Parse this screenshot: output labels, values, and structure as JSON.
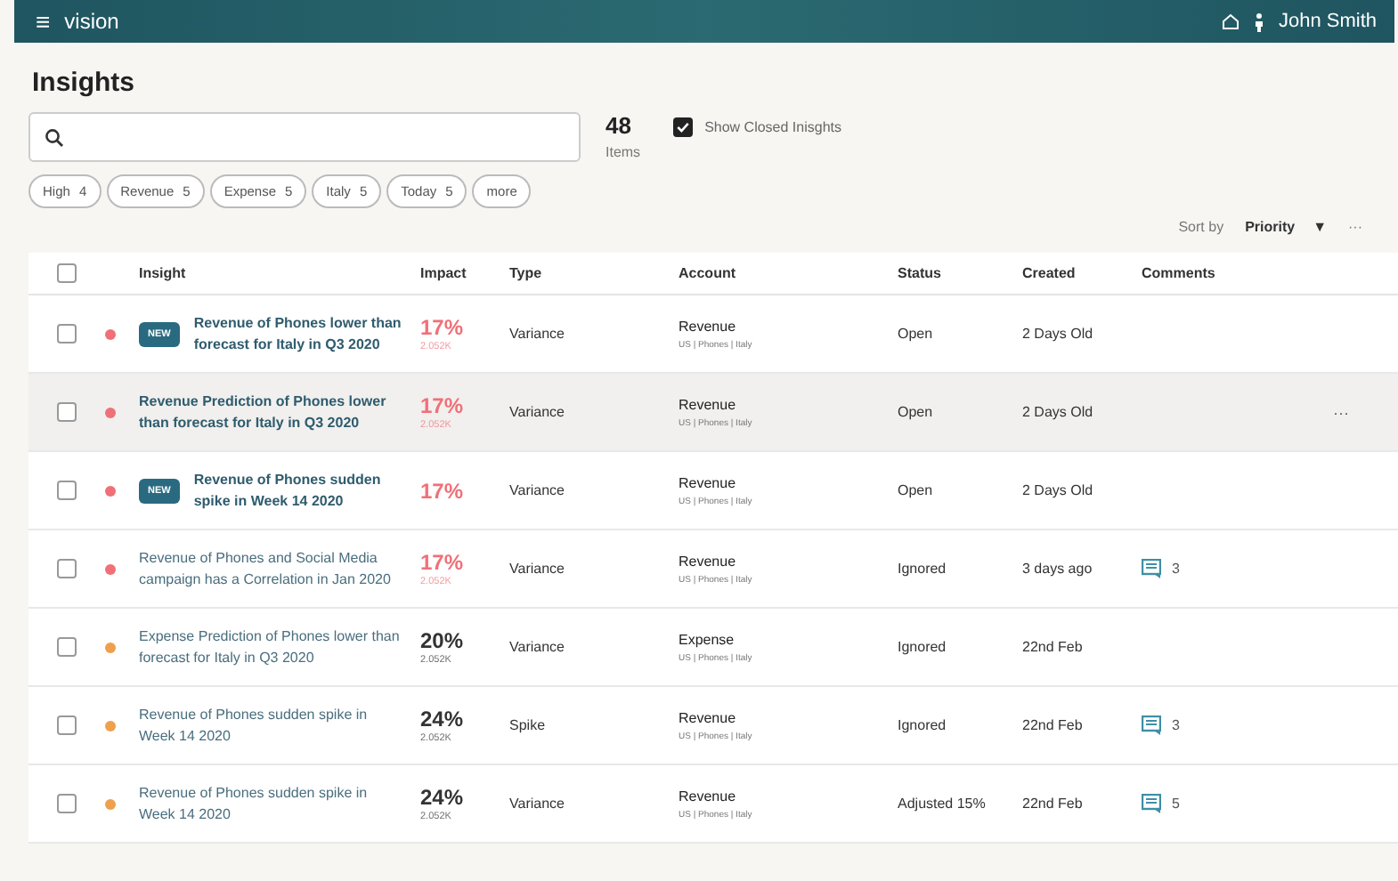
{
  "app_bar": {
    "menu_icon": "≡",
    "app_name": "vision",
    "user_name": "John Smith"
  },
  "page_title": "Insights",
  "search": {
    "kind": "text"
  },
  "count": {
    "value": "48",
    "label": "Items"
  },
  "show_closed": {
    "label": "Show Closed Inisghts",
    "checked": true
  },
  "filters": [
    {
      "label": "High",
      "count": "4"
    },
    {
      "label": "Revenue",
      "count": "5"
    },
    {
      "label": "Expense",
      "count": "5"
    },
    {
      "label": "Italy",
      "count": "5"
    },
    {
      "label": "Today",
      "count": "5"
    }
  ],
  "more_filters": "more",
  "sort": {
    "label": "Sort by",
    "value": "Priority",
    "caret": "▼",
    "menu": "···"
  },
  "table": {
    "select_all_checked": false,
    "columns": [
      "Insight",
      "Impact",
      "Type",
      "Account",
      "Status",
      "Created",
      "Comments"
    ],
    "rows": [
      {
        "checked": false,
        "hovered": false,
        "unread": true,
        "is_new": true,
        "badge": "NEW",
        "color": "#f07078",
        "title": "Revenue of Phones lower than forecast for Italy in Q3 2020",
        "impact": {
          "value": "17%",
          "detail": "2.052K",
          "color": "#f07078"
        },
        "type": "Variance",
        "account": "Revenue",
        "account_path": "US | Phones | Italy",
        "status": "Open",
        "created": "2 Days Old"
      },
      {
        "checked": false,
        "hovered": true,
        "unread": true,
        "is_new": false,
        "color": "#f07078",
        "title": "Revenue Prediction of Phones lower than forecast for Italy in Q3 2020",
        "impact": {
          "value": "17%",
          "detail": "2.052K",
          "color": "#f07078"
        },
        "type": "Variance",
        "account": "Revenue",
        "account_path": "US | Phones | Italy",
        "status": "Open",
        "created": "2 Days Old",
        "row_menu": "···"
      },
      {
        "checked": false,
        "hovered": false,
        "unread": true,
        "is_new": true,
        "badge": "NEW",
        "color": "#f07078",
        "title": "Revenue of Phones sudden spike in Week 14 2020",
        "impact": {
          "value": "17%",
          "color": "#f07078"
        },
        "type": "Variance",
        "account": "Revenue",
        "account_path": "US | Phones | Italy",
        "status": "Open",
        "created": "2 Days Old"
      },
      {
        "checked": false,
        "hovered": false,
        "unread": false,
        "is_new": false,
        "color": "#f07078",
        "title": "Revenue of Phones and Social Media campaign has a Correlation in Jan 2020",
        "impact": {
          "value": "17%",
          "detail": "2.052K",
          "color": "#f07078"
        },
        "type": "Variance",
        "account": "Revenue",
        "account_path": "US | Phones | Italy",
        "status": "Ignored",
        "created": "3 days ago",
        "comments": "3"
      },
      {
        "checked": false,
        "hovered": false,
        "unread": false,
        "is_new": false,
        "color": "#eea04c",
        "title": "Expense Prediction of Phones lower than forecast for Italy in Q3 2020",
        "impact": {
          "value": "20%",
          "detail": "2.052K",
          "color": "#333333"
        },
        "type": "Variance",
        "account": "Expense",
        "account_path": "US | Phones | Italy",
        "status": "Ignored",
        "created": "22nd Feb"
      },
      {
        "checked": false,
        "hovered": false,
        "unread": false,
        "is_new": false,
        "color": "#eea04c",
        "title": "Revenue of Phones sudden spike in Week 14 2020",
        "impact": {
          "value": "24%",
          "detail": "2.052K",
          "color": "#333333"
        },
        "type": "Spike",
        "account": "Revenue",
        "account_path": "US | Phones | Italy",
        "status": "Ignored",
        "created": "22nd Feb",
        "comments": "3"
      },
      {
        "checked": false,
        "hovered": false,
        "unread": false,
        "is_new": false,
        "color": "#eea04c",
        "title": "Revenue of Phones sudden spike in Week 14 2020",
        "impact": {
          "value": "24%",
          "detail": "2.052K",
          "color": "#333333"
        },
        "type": "Variance",
        "account": "Revenue",
        "account_path": "US | Phones | Italy",
        "status": "Adjusted 15%",
        "created": "22nd Feb",
        "comments": "5"
      }
    ]
  }
}
